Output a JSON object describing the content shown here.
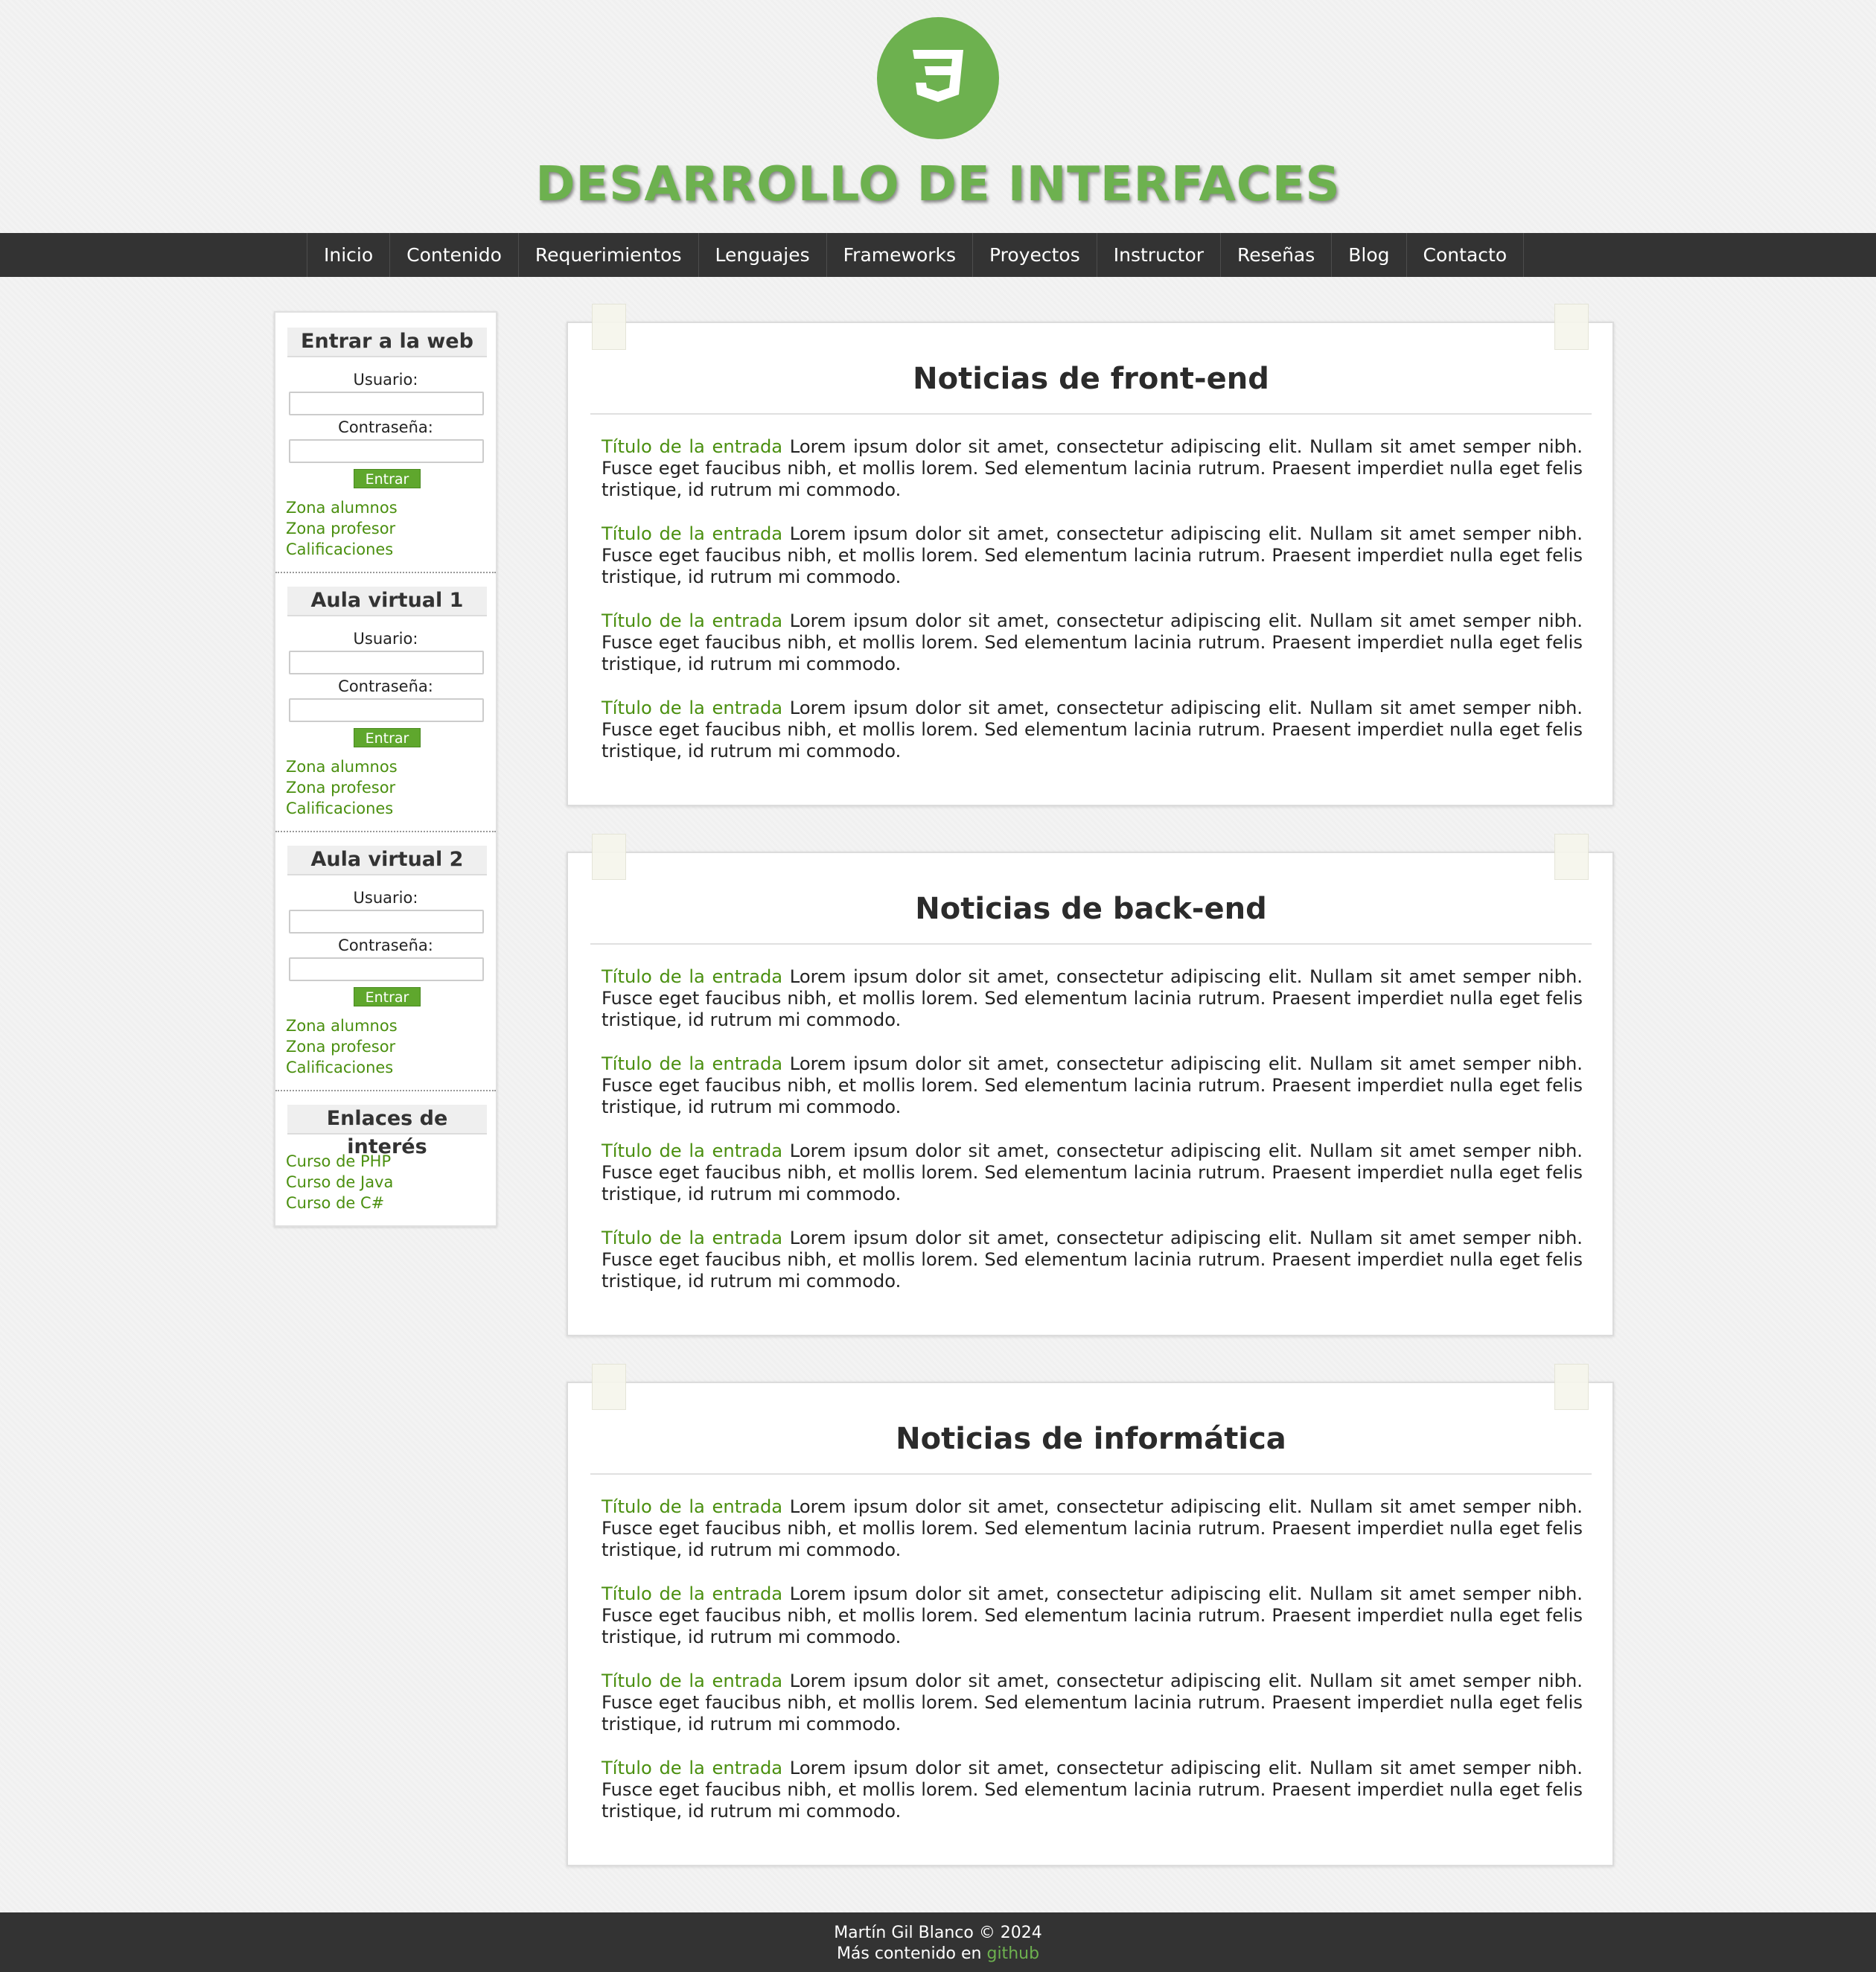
{
  "header": {
    "logo_icon": "css3-shield-icon",
    "title": "DESARROLLO DE INTERFACES",
    "accent_color": "#6db14f"
  },
  "nav": {
    "items": [
      "Inicio",
      "Contenido",
      "Requerimientos",
      "Lenguajes",
      "Frameworks",
      "Proyectos",
      "Instructor",
      "Reseñas",
      "Blog",
      "Contacto"
    ]
  },
  "sidebar": {
    "login_blocks": [
      {
        "title": "Entrar a la web",
        "user_label": "Usuario:",
        "password_label": "Contraseña:",
        "button": "Entrar",
        "links": [
          "Zona alumnos",
          "Zona profesor",
          "Calificaciones"
        ]
      },
      {
        "title": "Aula virtual 1",
        "user_label": "Usuario:",
        "password_label": "Contraseña:",
        "button": "Entrar",
        "links": [
          "Zona alumnos",
          "Zona profesor",
          "Calificaciones"
        ]
      },
      {
        "title": "Aula virtual 2",
        "user_label": "Usuario:",
        "password_label": "Contraseña:",
        "button": "Entrar",
        "links": [
          "Zona alumnos",
          "Zona profesor",
          "Calificaciones"
        ]
      }
    ],
    "links_block": {
      "title": "Enlaces de interés",
      "links": [
        "Curso de PHP",
        "Curso de Java",
        "Curso de C#"
      ]
    }
  },
  "main": {
    "cards": [
      {
        "title": "Noticias de front-end",
        "entries": [
          {
            "link": "Título de la entrada",
            "text": " Lorem ipsum dolor sit amet, consectetur adipiscing elit. Nullam sit amet semper nibh. Fusce eget faucibus nibh, et mollis lorem. Sed elementum lacinia rutrum. Praesent imperdiet nulla eget felis tristique, id rutrum mi commodo."
          },
          {
            "link": "Título de la entrada",
            "text": " Lorem ipsum dolor sit amet, consectetur adipiscing elit. Nullam sit amet semper nibh. Fusce eget faucibus nibh, et mollis lorem. Sed elementum lacinia rutrum. Praesent imperdiet nulla eget felis tristique, id rutrum mi commodo."
          },
          {
            "link": "Título de la entrada",
            "text": " Lorem ipsum dolor sit amet, consectetur adipiscing elit. Nullam sit amet semper nibh. Fusce eget faucibus nibh, et mollis lorem. Sed elementum lacinia rutrum. Praesent imperdiet nulla eget felis tristique, id rutrum mi commodo."
          },
          {
            "link": "Título de la entrada",
            "text": " Lorem ipsum dolor sit amet, consectetur adipiscing elit. Nullam sit amet semper nibh. Fusce eget faucibus nibh, et mollis lorem. Sed elementum lacinia rutrum. Praesent imperdiet nulla eget felis tristique, id rutrum mi commodo."
          }
        ]
      },
      {
        "title": "Noticias de back-end",
        "entries": [
          {
            "link": "Título de la entrada",
            "text": " Lorem ipsum dolor sit amet, consectetur adipiscing elit. Nullam sit amet semper nibh. Fusce eget faucibus nibh, et mollis lorem. Sed elementum lacinia rutrum. Praesent imperdiet nulla eget felis tristique, id rutrum mi commodo."
          },
          {
            "link": "Título de la entrada",
            "text": " Lorem ipsum dolor sit amet, consectetur adipiscing elit. Nullam sit amet semper nibh. Fusce eget faucibus nibh, et mollis lorem. Sed elementum lacinia rutrum. Praesent imperdiet nulla eget felis tristique, id rutrum mi commodo."
          },
          {
            "link": "Título de la entrada",
            "text": " Lorem ipsum dolor sit amet, consectetur adipiscing elit. Nullam sit amet semper nibh. Fusce eget faucibus nibh, et mollis lorem. Sed elementum lacinia rutrum. Praesent imperdiet nulla eget felis tristique, id rutrum mi commodo."
          },
          {
            "link": "Título de la entrada",
            "text": " Lorem ipsum dolor sit amet, consectetur adipiscing elit. Nullam sit amet semper nibh. Fusce eget faucibus nibh, et mollis lorem. Sed elementum lacinia rutrum. Praesent imperdiet nulla eget felis tristique, id rutrum mi commodo."
          }
        ]
      },
      {
        "title": "Noticias de informática",
        "entries": [
          {
            "link": "Título de la entrada",
            "text": " Lorem ipsum dolor sit amet, consectetur adipiscing elit. Nullam sit amet semper nibh. Fusce eget faucibus nibh, et mollis lorem. Sed elementum lacinia rutrum. Praesent imperdiet nulla eget felis tristique, id rutrum mi commodo."
          },
          {
            "link": "Título de la entrada",
            "text": " Lorem ipsum dolor sit amet, consectetur adipiscing elit. Nullam sit amet semper nibh. Fusce eget faucibus nibh, et mollis lorem. Sed elementum lacinia rutrum. Praesent imperdiet nulla eget felis tristique, id rutrum mi commodo."
          },
          {
            "link": "Título de la entrada",
            "text": " Lorem ipsum dolor sit amet, consectetur adipiscing elit. Nullam sit amet semper nibh. Fusce eget faucibus nibh, et mollis lorem. Sed elementum lacinia rutrum. Praesent imperdiet nulla eget felis tristique, id rutrum mi commodo."
          },
          {
            "link": "Título de la entrada",
            "text": " Lorem ipsum dolor sit amet, consectetur adipiscing elit. Nullam sit amet semper nibh. Fusce eget faucibus nibh, et mollis lorem. Sed elementum lacinia rutrum. Praesent imperdiet nulla eget felis tristique, id rutrum mi commodo."
          }
        ]
      }
    ]
  },
  "footer": {
    "line1": "Martín Gil Blanco © 2024",
    "line2_prefix": "Más contenido en ",
    "line2_link": "github"
  }
}
